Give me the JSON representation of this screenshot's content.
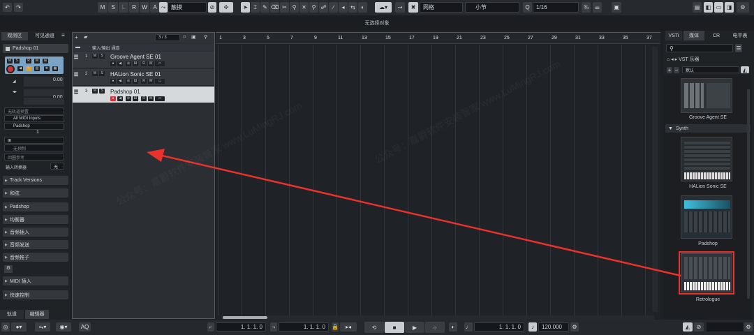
{
  "toolbar": {
    "modes": [
      "M",
      "S",
      "L",
      "R",
      "W",
      "A"
    ],
    "touch_mode": "触摸",
    "grid_type": "网格",
    "grid_unit": "小节",
    "quantize": "1/16"
  },
  "status_line": "无选择对象",
  "inspector": {
    "tabs": [
      "观测区",
      "可见通道"
    ],
    "track_name": "Padshop 01",
    "volume_value": "0.00",
    "pan_value": "0.00",
    "routing": [
      "无轨道预置",
      "All MIDI Inputs",
      "Padshop"
    ],
    "channel_number": "1",
    "no_bank": "无预制",
    "program_select": "回圈参考",
    "input_transform_label": "输入转换器",
    "input_transform_value": "无",
    "sections": [
      "Track Versions",
      "和弦",
      "Padshop",
      "均衡器",
      "音频插入",
      "音频发送",
      "音频推子",
      "MIDI 插入",
      "快速控制"
    ],
    "bottom_tabs": [
      "轨道",
      "编辑器"
    ]
  },
  "tracklist": {
    "count": "3 / 3",
    "folder_label": "输入/输出 通道",
    "tracks": [
      {
        "num": "1",
        "name": "Groove Agent SE 01"
      },
      {
        "num": "2",
        "name": "HALion Sonic SE 01"
      },
      {
        "num": "3",
        "name": "Padshop 01"
      }
    ]
  },
  "ruler": {
    "bars": [
      "1",
      "3",
      "5",
      "7",
      "9",
      "11",
      "13",
      "15",
      "17",
      "19",
      "21",
      "23",
      "25",
      "27",
      "29",
      "31",
      "33",
      "35",
      "37"
    ]
  },
  "media_bay": {
    "tabs": [
      "VSTi",
      "媒体",
      "CR",
      "电平表"
    ],
    "search_placeholder": "",
    "breadcrumb": "VST 乐器",
    "preset_filter": "默认",
    "category": "Synth",
    "instruments": [
      "Groove Agent SE",
      "HALion Sonic SE",
      "Padshop",
      "Retrologue"
    ]
  },
  "transport": {
    "left_locator": "1. 1. 1.   0",
    "right_locator": "1. 1. 1.   0",
    "position": "1. 1. 1.   0",
    "tempo": "120.000",
    "aq": "AQ"
  },
  "watermark": "公众号：嘉爵软件安装管家  www.LuMingRJ.com",
  "colors": {
    "arrow": "#e8322b",
    "selected_track": "#d6d9dc",
    "record": "#d0343a"
  }
}
